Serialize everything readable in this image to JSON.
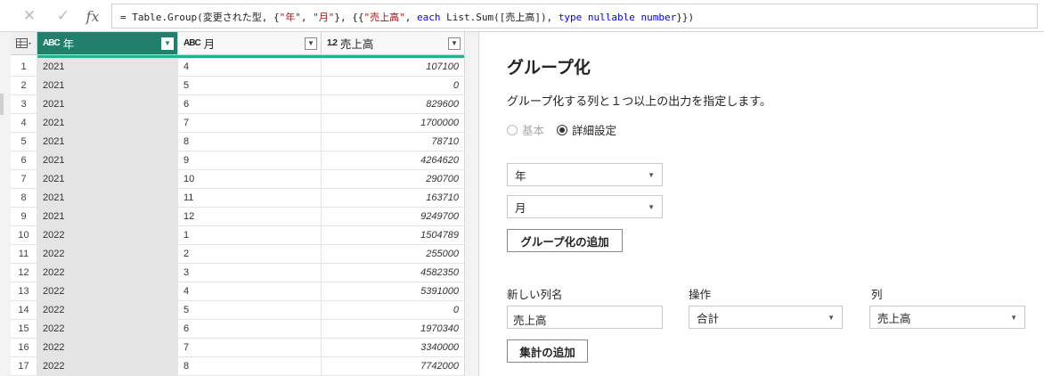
{
  "formula_bar": {
    "cancel_icon": "✕",
    "commit_icon": "✓",
    "fx_icon": "fx",
    "formula_parts": [
      {
        "t": "= Table.Group(変更された型, {",
        "c": ""
      },
      {
        "t": "\"年\"",
        "c": "tok-str"
      },
      {
        "t": ", ",
        "c": ""
      },
      {
        "t": "\"月\"",
        "c": "tok-str"
      },
      {
        "t": "}, {{",
        "c": ""
      },
      {
        "t": "\"売上高\"",
        "c": "tok-str"
      },
      {
        "t": ", ",
        "c": ""
      },
      {
        "t": "each",
        "c": "tok-kw"
      },
      {
        "t": " List.Sum([売上高]), ",
        "c": ""
      },
      {
        "t": "type nullable",
        "c": "tok-kw"
      },
      {
        "t": " ",
        "c": ""
      },
      {
        "t": "number",
        "c": "tok-kw"
      },
      {
        "t": "}})",
        "c": ""
      }
    ]
  },
  "grid": {
    "columns": [
      {
        "type": "ABC",
        "label": "年"
      },
      {
        "type": "ABC",
        "label": "月"
      },
      {
        "type": "1.2",
        "label": "売上高"
      }
    ],
    "rows": [
      [
        "1",
        "2021",
        "4",
        "107100"
      ],
      [
        "2",
        "2021",
        "5",
        "0"
      ],
      [
        "3",
        "2021",
        "6",
        "829600"
      ],
      [
        "4",
        "2021",
        "7",
        "1700000"
      ],
      [
        "5",
        "2021",
        "8",
        "78710"
      ],
      [
        "6",
        "2021",
        "9",
        "4264620"
      ],
      [
        "7",
        "2021",
        "10",
        "290700"
      ],
      [
        "8",
        "2021",
        "11",
        "163710"
      ],
      [
        "9",
        "2021",
        "12",
        "9249700"
      ],
      [
        "10",
        "2022",
        "1",
        "1504789"
      ],
      [
        "11",
        "2022",
        "2",
        "255000"
      ],
      [
        "12",
        "2022",
        "3",
        "4582350"
      ],
      [
        "13",
        "2022",
        "4",
        "5391000"
      ],
      [
        "14",
        "2022",
        "5",
        "0"
      ],
      [
        "15",
        "2022",
        "6",
        "1970340"
      ],
      [
        "16",
        "2022",
        "7",
        "3340000"
      ],
      [
        "17",
        "2022",
        "8",
        "7742000"
      ]
    ]
  },
  "dialog": {
    "title": "グループ化",
    "description": "グループ化する列と１つ以上の出力を指定します。",
    "radio_basic": "基本",
    "radio_advanced": "詳細設定",
    "group_by_1": "年",
    "group_by_2": "月",
    "add_grouping_button": "グループ化の追加",
    "new_column_label": "新しい列名",
    "operation_label": "操作",
    "column_label": "列",
    "new_column_value": "売上高",
    "operation_value": "合計",
    "column_value": "売上高",
    "add_aggregation_button": "集計の追加"
  }
}
